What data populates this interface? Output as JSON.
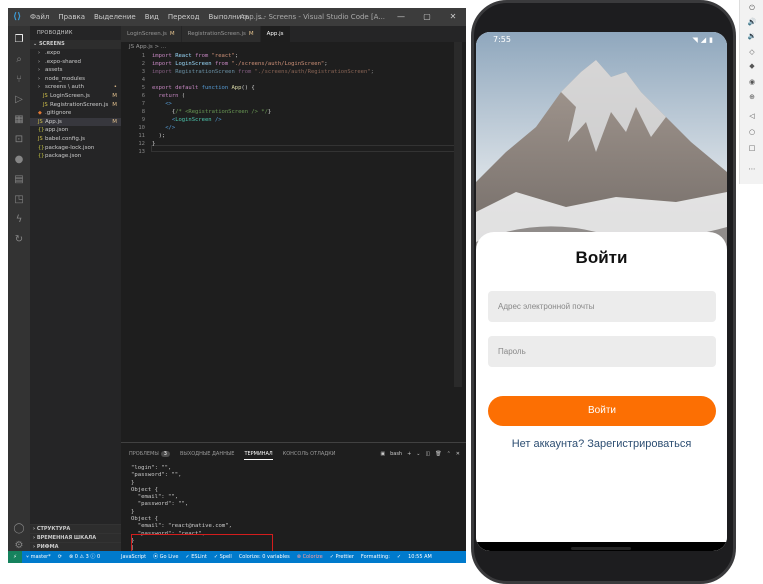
{
  "vscode": {
    "menu": [
      "Файл",
      "Правка",
      "Выделение",
      "Вид",
      "Переход",
      "Выполнить",
      "..."
    ],
    "title": "App.js - Screens - Visual Studio Code [A...",
    "explorer_header": "ПРОВОДНИК",
    "project": "SCREENS",
    "tree": [
      {
        "label": ".expo",
        "indent": 1,
        "kind": "folder",
        "mark": ""
      },
      {
        "label": ".expo-shared",
        "indent": 1,
        "kind": "folder",
        "mark": ""
      },
      {
        "label": "assets",
        "indent": 1,
        "kind": "folder",
        "mark": ""
      },
      {
        "label": "node_modules",
        "indent": 1,
        "kind": "folder",
        "mark": ""
      },
      {
        "label": "screens \\ auth",
        "indent": 1,
        "kind": "folder",
        "mark": "•"
      },
      {
        "label": "LoginScreen.js",
        "indent": 2,
        "kind": "js",
        "mark": "M"
      },
      {
        "label": "RegistrationScreen.js",
        "indent": 2,
        "kind": "js",
        "mark": "M"
      },
      {
        "label": ".gitignore",
        "indent": 1,
        "kind": "file",
        "mark": ""
      },
      {
        "label": "App.js",
        "indent": 1,
        "kind": "js",
        "mark": "M",
        "selected": true
      },
      {
        "label": "app.json",
        "indent": 1,
        "kind": "json",
        "mark": ""
      },
      {
        "label": "babel.config.js",
        "indent": 1,
        "kind": "js",
        "mark": ""
      },
      {
        "label": "package-lock.json",
        "indent": 1,
        "kind": "json",
        "mark": ""
      },
      {
        "label": "package.json",
        "indent": 1,
        "kind": "json",
        "mark": ""
      }
    ],
    "bottom_sections": [
      "СТРУКТУРА",
      "ВРЕМЕННАЯ ШКАЛА",
      "РИФМА"
    ],
    "tabs": [
      {
        "label": "LoginScreen.js",
        "mark": "M",
        "active": false
      },
      {
        "label": "RegistrationScreen.js",
        "mark": "M",
        "active": false
      },
      {
        "label": "App.js",
        "mark": "",
        "active": true
      }
    ],
    "breadcrumb": "JS App.js > ...",
    "code_lines": [
      "1",
      "2",
      "3",
      "4",
      "5",
      "6",
      "7",
      "8",
      "9",
      "10",
      "11",
      "12",
      "13"
    ],
    "panel_tabs": [
      "ПРОБЛЕМЫ",
      "ВЫХОДНЫЕ ДАННЫЕ",
      "ТЕРМИНАЛ",
      "КОНСОЛЬ ОТЛАДКИ"
    ],
    "problems_count": "3",
    "panel_controls": "bash",
    "terminal": [
      "\"login\": \"\",",
      "\"password\": \"\",",
      "}",
      "Object {",
      "  \"email\": \"\",",
      "  \"password\": \"\",",
      "}",
      "Object {",
      "  \"email\": \"react@native.com\",",
      "  \"password\": \"react\",",
      "}",
      "|"
    ],
    "status": {
      "branch": "master*",
      "errors": "0",
      "warnings": "3",
      "warn2": "0",
      "language": "JavaScript",
      "go_live": "Go Live",
      "eslint": "ESLint",
      "spell": "Spell",
      "colorize": "Colorize: 0 variables",
      "colorize2": "Colorize",
      "prettier": "Prettier",
      "formatting": "Formatting:",
      "time": "10:55 AM"
    }
  },
  "phone": {
    "time": "7:55",
    "title": "Войти",
    "email_placeholder": "Адрес электронной почты",
    "password_placeholder": "Пароль",
    "login_button": "Войти",
    "register_link": "Нет аккаунта? Зарегистрироваться",
    "accent": "#fc6f03",
    "link_color": "#2d4e72"
  }
}
